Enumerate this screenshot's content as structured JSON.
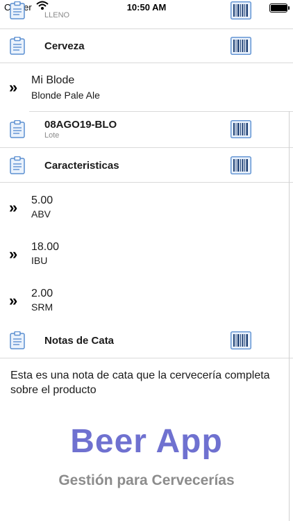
{
  "status": {
    "carrier": "Carrier",
    "time": "10:50 AM",
    "battery_level": 0.95
  },
  "top_row": {
    "subtitle": "LLENO"
  },
  "sections": {
    "cerveza": "Cerveza",
    "caracteristicas": "Caracteristicas",
    "notas": "Notas de Cata"
  },
  "beer": {
    "name": "Mi Blode",
    "style": "Blonde Pale Ale"
  },
  "lot": {
    "code": "08AGO19-BLO",
    "label": "Lote"
  },
  "characteristics": [
    {
      "value": "5.00",
      "label": "ABV"
    },
    {
      "value": "18.00",
      "label": "IBU"
    },
    {
      "value": "2.00",
      "label": "SRM"
    }
  ],
  "tasting_notes": "Esta es una nota de cata que la cervecería completa sobre el producto",
  "logo": {
    "title": "Beer App",
    "subtitle": "Gestión para Cervecerías"
  },
  "colors": {
    "icon_blue": "#5b8fd1",
    "logo_purple": "#6f71d0",
    "logo_gray": "#8c8c8c"
  },
  "icons": {
    "row_icon": "clipboard-icon",
    "action_icon": "barcode-icon",
    "disclosure": "double-chevron-icon"
  }
}
